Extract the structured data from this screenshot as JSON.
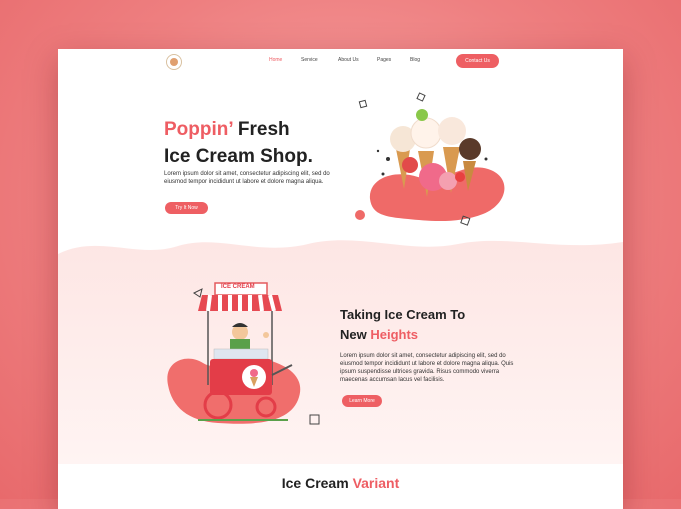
{
  "nav": {
    "items": [
      "Home",
      "Service",
      "About Us",
      "Pages",
      "Blog"
    ],
    "contact": "Contact Us"
  },
  "hero": {
    "title_accent": "Poppin’",
    "title_rest": " Fresh",
    "title_line2": "Ice Cream Shop.",
    "text": "Lorem ipsum dolor sit amet, consectetur adipiscing elit, sed do eiusmod tempor incididunt ut labore et dolore magna aliqua.",
    "button": "Try It Now"
  },
  "section2": {
    "cart_sign": "ICE CREAM",
    "title_line1": "Taking Ice Cream To",
    "title_line2_plain": "New ",
    "title_line2_accent": "Heights",
    "text": "Lorem ipsum dolor sit amet, consectetur adipiscing elit, sed do eiusmod tempor incididunt ut labore et dolore magna aliqua. Quis ipsum suspendisse ultrices gravida. Risus commodo viverra maecenas accumsan lacus vel facilisis.",
    "button": "Learn More"
  },
  "variant": {
    "plain": "Ice Cream ",
    "accent": "Variant"
  },
  "colors": {
    "accent": "#ee5f63",
    "background": "#ee7f80"
  }
}
